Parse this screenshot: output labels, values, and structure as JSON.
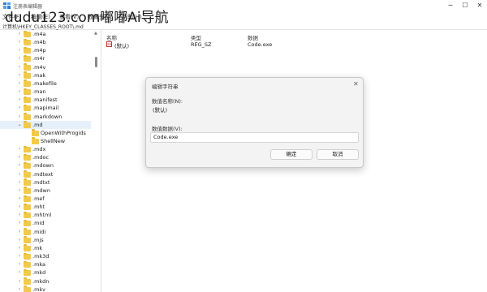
{
  "window": {
    "title": "注册表编辑器",
    "minimize": "─",
    "maximize": "☐",
    "close": "✕"
  },
  "watermark": "dudu123.com嘟嘟Ai导航",
  "menu": [
    "文件(F)",
    "编辑(E)",
    "查看(V)",
    "收藏夹(A)",
    "帮助(H)"
  ],
  "address": "计算机\\HKEY_CLASSES_ROOT\\.md",
  "tree": [
    {
      "label": ".m4a",
      "expanded": false
    },
    {
      "label": ".m4b",
      "expanded": false
    },
    {
      "label": ".m4p",
      "expanded": false
    },
    {
      "label": ".m4r",
      "expanded": false
    },
    {
      "label": ".m4v",
      "expanded": false
    },
    {
      "label": ".mak",
      "expanded": false
    },
    {
      "label": ".makefile",
      "expanded": false
    },
    {
      "label": ".man",
      "expanded": false
    },
    {
      "label": ".manifest",
      "expanded": false
    },
    {
      "label": ".mapimail",
      "expanded": false
    },
    {
      "label": ".markdown",
      "expanded": false
    },
    {
      "label": ".md",
      "expanded": true,
      "selected": true
    },
    {
      "label": "OpenWithProgids",
      "child": true
    },
    {
      "label": "ShellNew",
      "child": true
    },
    {
      "label": ".mdx",
      "expanded": false
    },
    {
      "label": ".mdoc",
      "expanded": false
    },
    {
      "label": ".mdown",
      "expanded": false
    },
    {
      "label": ".mdtext",
      "expanded": false
    },
    {
      "label": ".mdtxt",
      "expanded": false
    },
    {
      "label": ".mdwn",
      "expanded": false
    },
    {
      "label": ".mef",
      "expanded": false
    },
    {
      "label": ".mht",
      "expanded": false
    },
    {
      "label": ".mhtml",
      "expanded": false
    },
    {
      "label": ".mid",
      "expanded": false
    },
    {
      "label": ".midi",
      "expanded": false
    },
    {
      "label": ".mjs",
      "expanded": false
    },
    {
      "label": ".mk",
      "expanded": false
    },
    {
      "label": ".mk3d",
      "expanded": false
    },
    {
      "label": ".mka",
      "expanded": false
    },
    {
      "label": ".mkd",
      "expanded": false
    },
    {
      "label": ".mkdn",
      "expanded": false
    },
    {
      "label": ".mkv",
      "expanded": false
    }
  ],
  "list": {
    "headers": {
      "name": "名称",
      "type": "类型",
      "data": "数据"
    },
    "rows": [
      {
        "icon": "ab",
        "name": "(默认)",
        "type": "REG_SZ",
        "data": "Code.exe"
      }
    ]
  },
  "dialog": {
    "title": "编辑字符串",
    "close": "✕",
    "name_label": "数值名称(N):",
    "name_value": "(默认)",
    "data_label": "数值数据(V):",
    "data_value": "Code.exe",
    "ok": "确定",
    "cancel": "取消"
  },
  "colors": {
    "folder": "#f2c94c",
    "selection": "#e5f0fb",
    "dialog_bg": "#f3f3f3"
  }
}
